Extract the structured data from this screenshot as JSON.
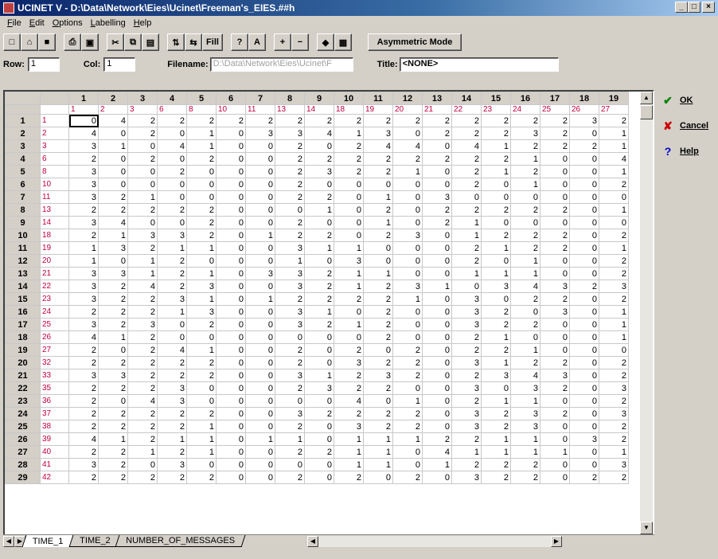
{
  "window": {
    "title": "UCINET V  -  D:\\Data\\Network\\Eies\\Ucinet\\Freeman's_EIES.##h",
    "controls": [
      "_",
      "□",
      "×"
    ]
  },
  "menu": [
    {
      "accel": "F",
      "rest": "ile"
    },
    {
      "accel": "E",
      "rest": "dit"
    },
    {
      "accel": "O",
      "rest": "ptions"
    },
    {
      "accel": "L",
      "rest": "abelling"
    },
    {
      "accel": "H",
      "rest": "elp"
    }
  ],
  "toolbar": {
    "buttons": [
      {
        "name": "new-file-icon",
        "glyph": "□"
      },
      {
        "name": "open-folder-icon",
        "glyph": "⌂"
      },
      {
        "name": "save-icon",
        "glyph": "■"
      },
      {
        "name": "print-icon",
        "glyph": "⎙"
      },
      {
        "name": "print-preview-icon",
        "glyph": "▣"
      },
      {
        "name": "cut-icon",
        "glyph": "✂"
      },
      {
        "name": "copy-icon",
        "glyph": "⧉"
      },
      {
        "name": "paste-icon",
        "glyph": "▤"
      },
      {
        "name": "insert-rows-icon",
        "glyph": "⇅"
      },
      {
        "name": "insert-cols-icon",
        "glyph": "⇆"
      },
      {
        "name": "fill-button",
        "glyph": "Fill"
      },
      {
        "name": "help-icon",
        "glyph": "?"
      },
      {
        "name": "font-icon",
        "glyph": "A"
      },
      {
        "name": "plus-icon",
        "glyph": "+"
      },
      {
        "name": "minus-icon",
        "glyph": "−"
      },
      {
        "name": "eraser-icon",
        "glyph": "◆"
      },
      {
        "name": "calculator-icon",
        "glyph": "▦"
      }
    ],
    "mode_label": "Asymmetric Mode"
  },
  "fields": {
    "row_label": "Row:",
    "row_value": "1",
    "col_label": "Col:",
    "col_value": "1",
    "filename_label": "Filename:",
    "filename_value": "D:\\Data\\Network\\Eies\\Ucinet\\F",
    "title_label": "Title:",
    "title_value": "<NONE>"
  },
  "grid": {
    "col_numbers": [
      "1",
      "2",
      "3",
      "4",
      "5",
      "6",
      "7",
      "8",
      "9",
      "10",
      "11",
      "12",
      "13",
      "14",
      "15",
      "16",
      "17",
      "18",
      "19"
    ],
    "col_labels": [
      "1",
      "2",
      "3",
      "6",
      "8",
      "10",
      "11",
      "13",
      "14",
      "18",
      "19",
      "20",
      "21",
      "22",
      "23",
      "24",
      "25",
      "26",
      "27"
    ],
    "row_labels": [
      "1",
      "2",
      "3",
      "6",
      "8",
      "10",
      "11",
      "13",
      "14",
      "18",
      "19",
      "20",
      "21",
      "22",
      "23",
      "24",
      "25",
      "26",
      "27",
      "32",
      "33",
      "35",
      "36",
      "37",
      "38",
      "39",
      "40",
      "41",
      "42"
    ],
    "rows": [
      [
        0,
        4,
        2,
        2,
        2,
        2,
        2,
        2,
        2,
        2,
        2,
        2,
        2,
        2,
        2,
        2,
        2,
        3,
        2
      ],
      [
        4,
        0,
        2,
        0,
        1,
        0,
        3,
        3,
        4,
        1,
        3,
        0,
        2,
        2,
        2,
        3,
        2,
        0,
        1
      ],
      [
        3,
        1,
        0,
        4,
        1,
        0,
        0,
        2,
        0,
        2,
        4,
        4,
        0,
        4,
        1,
        2,
        2,
        2,
        1
      ],
      [
        2,
        0,
        2,
        0,
        2,
        0,
        0,
        2,
        2,
        2,
        2,
        2,
        2,
        2,
        2,
        1,
        0,
        0,
        4
      ],
      [
        3,
        0,
        0,
        2,
        0,
        0,
        0,
        2,
        3,
        2,
        2,
        1,
        0,
        2,
        1,
        2,
        0,
        0,
        1
      ],
      [
        3,
        0,
        0,
        0,
        0,
        0,
        0,
        2,
        0,
        0,
        0,
        0,
        0,
        2,
        0,
        1,
        0,
        0,
        2
      ],
      [
        3,
        2,
        1,
        0,
        0,
        0,
        0,
        2,
        2,
        0,
        1,
        0,
        3,
        0,
        0,
        0,
        0,
        0,
        0
      ],
      [
        2,
        2,
        2,
        2,
        2,
        0,
        0,
        0,
        1,
        0,
        2,
        0,
        2,
        2,
        2,
        2,
        2,
        0,
        1
      ],
      [
        3,
        4,
        0,
        0,
        2,
        0,
        0,
        2,
        0,
        0,
        1,
        0,
        2,
        1,
        0,
        0,
        0,
        0,
        0
      ],
      [
        2,
        1,
        3,
        3,
        2,
        0,
        1,
        2,
        2,
        0,
        2,
        3,
        0,
        1,
        2,
        2,
        2,
        0,
        2
      ],
      [
        1,
        3,
        2,
        1,
        1,
        0,
        0,
        3,
        1,
        1,
        0,
        0,
        0,
        2,
        1,
        2,
        2,
        0,
        1
      ],
      [
        1,
        0,
        1,
        2,
        0,
        0,
        0,
        1,
        0,
        3,
        0,
        0,
        0,
        2,
        0,
        1,
        0,
        0,
        2
      ],
      [
        3,
        3,
        1,
        2,
        1,
        0,
        3,
        3,
        2,
        1,
        1,
        0,
        0,
        1,
        1,
        1,
        0,
        0,
        2
      ],
      [
        3,
        2,
        4,
        2,
        3,
        0,
        0,
        3,
        2,
        1,
        2,
        3,
        1,
        0,
        3,
        4,
        3,
        2,
        3
      ],
      [
        3,
        2,
        2,
        3,
        1,
        0,
        1,
        2,
        2,
        2,
        2,
        1,
        0,
        3,
        0,
        2,
        2,
        0,
        2
      ],
      [
        2,
        2,
        2,
        1,
        3,
        0,
        0,
        3,
        1,
        0,
        2,
        0,
        0,
        3,
        2,
        0,
        3,
        0,
        1
      ],
      [
        3,
        2,
        3,
        0,
        2,
        0,
        0,
        3,
        2,
        1,
        2,
        0,
        0,
        3,
        2,
        2,
        0,
        0,
        1
      ],
      [
        4,
        1,
        2,
        0,
        0,
        0,
        0,
        0,
        0,
        0,
        2,
        0,
        0,
        2,
        1,
        0,
        0,
        0,
        1
      ],
      [
        2,
        0,
        2,
        4,
        1,
        0,
        0,
        2,
        0,
        2,
        0,
        2,
        0,
        2,
        2,
        1,
        0,
        0,
        0
      ],
      [
        2,
        2,
        2,
        2,
        2,
        0,
        0,
        2,
        0,
        3,
        2,
        2,
        0,
        3,
        1,
        2,
        2,
        0,
        2
      ],
      [
        3,
        3,
        2,
        2,
        2,
        0,
        0,
        3,
        1,
        2,
        3,
        2,
        0,
        2,
        3,
        4,
        3,
        0,
        2
      ],
      [
        2,
        2,
        2,
        3,
        0,
        0,
        0,
        2,
        3,
        2,
        2,
        0,
        0,
        3,
        0,
        3,
        2,
        0,
        3
      ],
      [
        2,
        0,
        4,
        3,
        0,
        0,
        0,
        0,
        0,
        4,
        0,
        1,
        0,
        2,
        1,
        1,
        0,
        0,
        2
      ],
      [
        2,
        2,
        2,
        2,
        2,
        0,
        0,
        3,
        2,
        2,
        2,
        2,
        0,
        3,
        2,
        3,
        2,
        0,
        3
      ],
      [
        2,
        2,
        2,
        2,
        1,
        0,
        0,
        2,
        0,
        3,
        2,
        2,
        0,
        3,
        2,
        3,
        0,
        0,
        2
      ],
      [
        4,
        1,
        2,
        1,
        1,
        0,
        1,
        1,
        0,
        1,
        1,
        1,
        2,
        2,
        1,
        1,
        0,
        3,
        2
      ],
      [
        2,
        2,
        1,
        2,
        1,
        0,
        0,
        2,
        2,
        1,
        1,
        0,
        4,
        1,
        1,
        1,
        1,
        0,
        1
      ],
      [
        3,
        2,
        0,
        3,
        0,
        0,
        0,
        0,
        0,
        1,
        1,
        0,
        1,
        2,
        2,
        2,
        0,
        0,
        3
      ],
      [
        2,
        2,
        2,
        2,
        2,
        0,
        0,
        2,
        0,
        2,
        0,
        2,
        0,
        3,
        2,
        2,
        0,
        2,
        2
      ]
    ]
  },
  "sheet_tabs": [
    "TIME_1",
    "TIME_2",
    "NUMBER_OF_MESSAGES"
  ],
  "side_buttons": [
    {
      "name": "ok-button",
      "icon": "check-icon",
      "glyph": "✔",
      "color": "#008000",
      "label": "OK"
    },
    {
      "name": "cancel-button",
      "icon": "x-icon",
      "glyph": "✘",
      "color": "#cc0000",
      "label": "Cancel"
    },
    {
      "name": "help-button",
      "icon": "question-icon",
      "glyph": "?",
      "color": "#0000cc",
      "label": "Help"
    }
  ]
}
